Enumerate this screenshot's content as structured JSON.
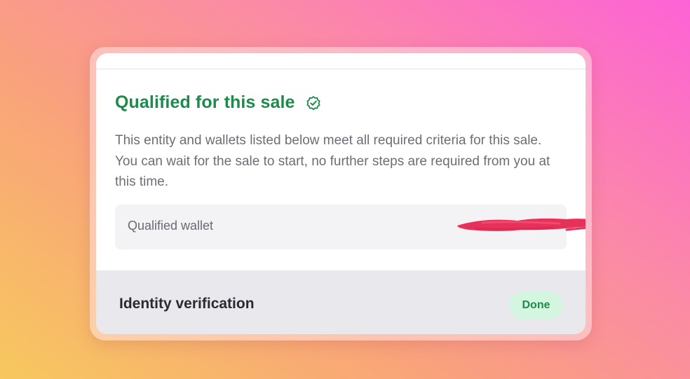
{
  "qualification": {
    "title": "Qualified for this sale",
    "status_icon": "check-circle-icon",
    "description": "This entity and wallets listed below meet all required criteria for this sale. You can wait for the sale to start, no further steps are required from you at this time.",
    "accent_color": "#1e8a4c"
  },
  "wallet": {
    "label": "Qualified wallet",
    "value_redacted": true,
    "redaction_color": "#e8315a"
  },
  "identity": {
    "label": "Identity verification",
    "status": "Done",
    "status_color": "#1f8a4a",
    "status_bg": "#d4f5e0"
  }
}
